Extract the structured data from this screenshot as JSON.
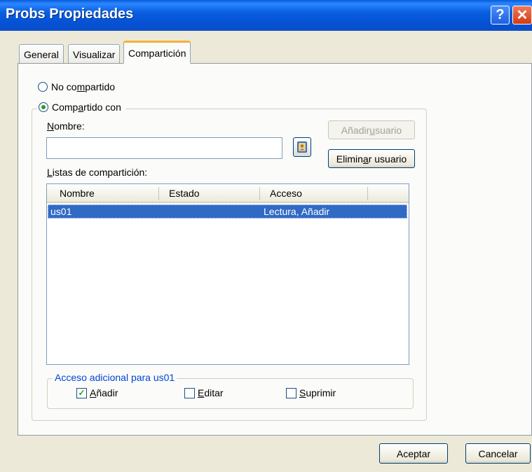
{
  "window": {
    "title": "Probs Propiedades",
    "help_glyph": "?",
    "close_glyph": "✕"
  },
  "tabs": [
    "General",
    "Visualizar",
    "Compartición"
  ],
  "sharing": {
    "not_shared": {
      "pre": "No co",
      "u": "m",
      "post": "partido"
    },
    "shared_with": {
      "pre": "Comp",
      "u": "a",
      "post": "rtido con"
    },
    "name_label": {
      "pre": "",
      "u": "N",
      "post": "ombre:"
    },
    "name_value": "",
    "add_user": {
      "pre": "Añadir ",
      "u": "u",
      "post": "suario"
    },
    "remove_user": {
      "pre": "Elimin",
      "u": "a",
      "post": "r usuario"
    },
    "share_list_label": {
      "pre": "",
      "u": "L",
      "post": "istas de compartición:"
    }
  },
  "list": {
    "columns": [
      "Nombre",
      "Estado",
      "Acceso"
    ],
    "rows": [
      {
        "name": "us01",
        "status": "",
        "access": "Lectura, Añadir"
      }
    ]
  },
  "additional_access": {
    "legend": "Acceso adicional para us01",
    "add": {
      "pre": "",
      "u": "A",
      "post": "ñadir",
      "checked_glyph": "✓"
    },
    "edit": {
      "pre": "",
      "u": "E",
      "post": "ditar",
      "checked_glyph": ""
    },
    "delete": {
      "pre": "",
      "u": "S",
      "post": "uprimir",
      "checked_glyph": ""
    }
  },
  "footer": {
    "accept": "Aceptar",
    "cancel": "Cancelar"
  },
  "colors": {
    "titlebar": "#0a5fe0",
    "selection": "#316ac5",
    "accent_tab": "#f5b03a",
    "group_legend": "#0046d5"
  },
  "icons": [
    "help-icon",
    "close-icon",
    "address-book-icon"
  ]
}
